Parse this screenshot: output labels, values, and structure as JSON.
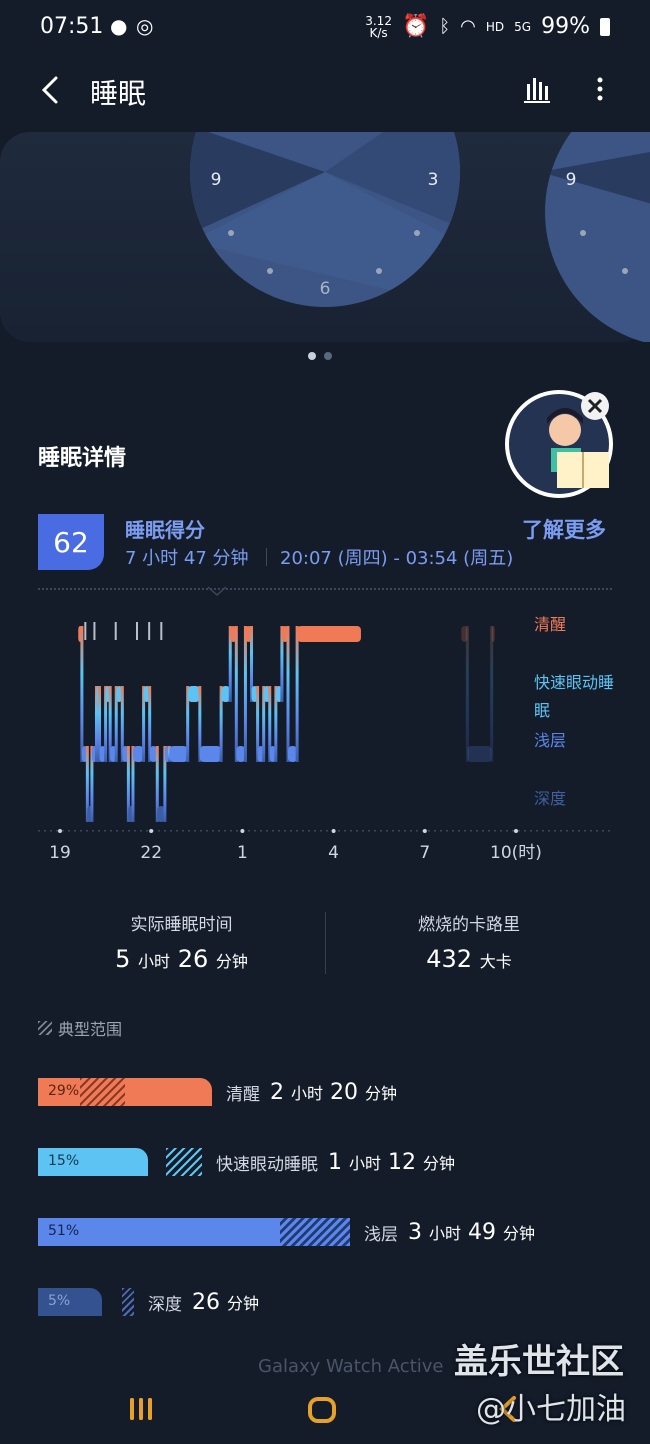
{
  "status_bar": {
    "time": "07:51",
    "net_speed_value": "3.12",
    "net_speed_unit": "K/s",
    "hd": "HD",
    "network": "5G",
    "battery": "99%"
  },
  "app_bar": {
    "title": "睡眠"
  },
  "clock": {
    "main_labels": [
      "9",
      "3",
      "6"
    ],
    "peek_labels": [
      "9"
    ]
  },
  "pager": {
    "count": 2,
    "active": 0
  },
  "details": {
    "section_title": "睡眠详情",
    "score": "62",
    "score_label": "睡眠得分",
    "learn_more": "了解更多",
    "duration": "7 小时 47 分钟",
    "time_range": "20:07 (周四) - 03:54 (周五)"
  },
  "chart_data": {
    "type": "line",
    "stages": [
      "清醒",
      "快速眼动睡眠",
      "浅层",
      "深度"
    ],
    "x_ticks": [
      "19",
      "22",
      "1",
      "4",
      "7",
      "10(时)"
    ],
    "xlim": [
      19,
      34
    ],
    "segments": [
      [
        19.6,
        19.72,
        "清醒"
      ],
      [
        19.72,
        19.9,
        "浅层"
      ],
      [
        19.9,
        20.05,
        "深度"
      ],
      [
        20.05,
        20.2,
        "浅层"
      ],
      [
        20.2,
        20.3,
        "快速眼动睡眠"
      ],
      [
        20.3,
        20.5,
        "浅层"
      ],
      [
        20.5,
        20.65,
        "快速眼动睡眠"
      ],
      [
        20.65,
        20.85,
        "浅层"
      ],
      [
        20.85,
        21.05,
        "快速眼动睡眠"
      ],
      [
        21.05,
        21.25,
        "浅层"
      ],
      [
        21.25,
        21.4,
        "深度"
      ],
      [
        21.4,
        21.75,
        "浅层"
      ],
      [
        21.75,
        21.95,
        "快速眼动睡眠"
      ],
      [
        21.95,
        22.2,
        "浅层"
      ],
      [
        22.2,
        22.45,
        "深度"
      ],
      [
        22.45,
        22.6,
        "浅层"
      ],
      [
        22.6,
        23.2,
        "浅层"
      ],
      [
        23.2,
        23.6,
        "快速眼动睡眠"
      ],
      [
        23.6,
        24.3,
        "浅层"
      ],
      [
        24.3,
        24.6,
        "快速眼动睡眠"
      ],
      [
        24.6,
        24.8,
        "清醒"
      ],
      [
        24.8,
        25.1,
        "浅层"
      ],
      [
        25.1,
        25.3,
        "清醒"
      ],
      [
        25.3,
        25.5,
        "快速眼动睡眠"
      ],
      [
        25.5,
        25.7,
        "浅层"
      ],
      [
        25.7,
        25.9,
        "快速眼动睡眠"
      ],
      [
        25.9,
        26.1,
        "浅层"
      ],
      [
        26.1,
        26.3,
        "快速眼动睡眠"
      ],
      [
        26.3,
        26.5,
        "清醒"
      ],
      [
        26.5,
        26.8,
        "浅层"
      ],
      [
        26.8,
        28.9,
        "清醒"
      ]
    ],
    "wake_ticks": [
      19.8,
      20.1,
      20.8,
      21.5,
      21.9,
      22.3
    ],
    "faded_segments": [
      [
        32.2,
        32.4,
        "清醒"
      ],
      [
        32.4,
        33.2,
        "浅层"
      ],
      [
        33.2,
        33.3,
        "清醒"
      ]
    ],
    "colors": {
      "清醒": "#f07a56",
      "快速眼动睡眠": "#5cc3f2",
      "浅层": "#5b86ea",
      "深度": "#3b5da6"
    }
  },
  "stats": {
    "actual_label": "实际睡眠时间",
    "actual_h": "5",
    "actual_h_unit": "小时",
    "actual_m": "26",
    "actual_m_unit": "分钟",
    "cal_label": "燃烧的卡路里",
    "cal_value": "432",
    "cal_unit": "大卡"
  },
  "typical_range": "典型范围",
  "breakdown": [
    {
      "pct": "29%",
      "fraction": 0.29,
      "label": "清醒",
      "h": "2",
      "h_unit": "小时",
      "m": "20",
      "m_unit": "分钟",
      "color": "#f07a56"
    },
    {
      "pct": "15%",
      "fraction": 0.15,
      "label": "快速眼动睡眠",
      "h": "1",
      "h_unit": "小时",
      "m": "12",
      "m_unit": "分钟",
      "color": "#5cc3f2"
    },
    {
      "pct": "51%",
      "fraction": 0.51,
      "label": "浅层",
      "h": "3",
      "h_unit": "小时",
      "m": "49",
      "m_unit": "分钟",
      "color": "#5b86ea"
    },
    {
      "pct": "5%",
      "fraction": 0.05,
      "label": "深度",
      "h": "",
      "h_unit": "",
      "m": "26",
      "m_unit": "分钟",
      "color": "#34528f"
    }
  ],
  "footer_text": "Galaxy Watch Active",
  "watermark": {
    "line1": "盖乐世社区",
    "line2": "@小七加油"
  }
}
